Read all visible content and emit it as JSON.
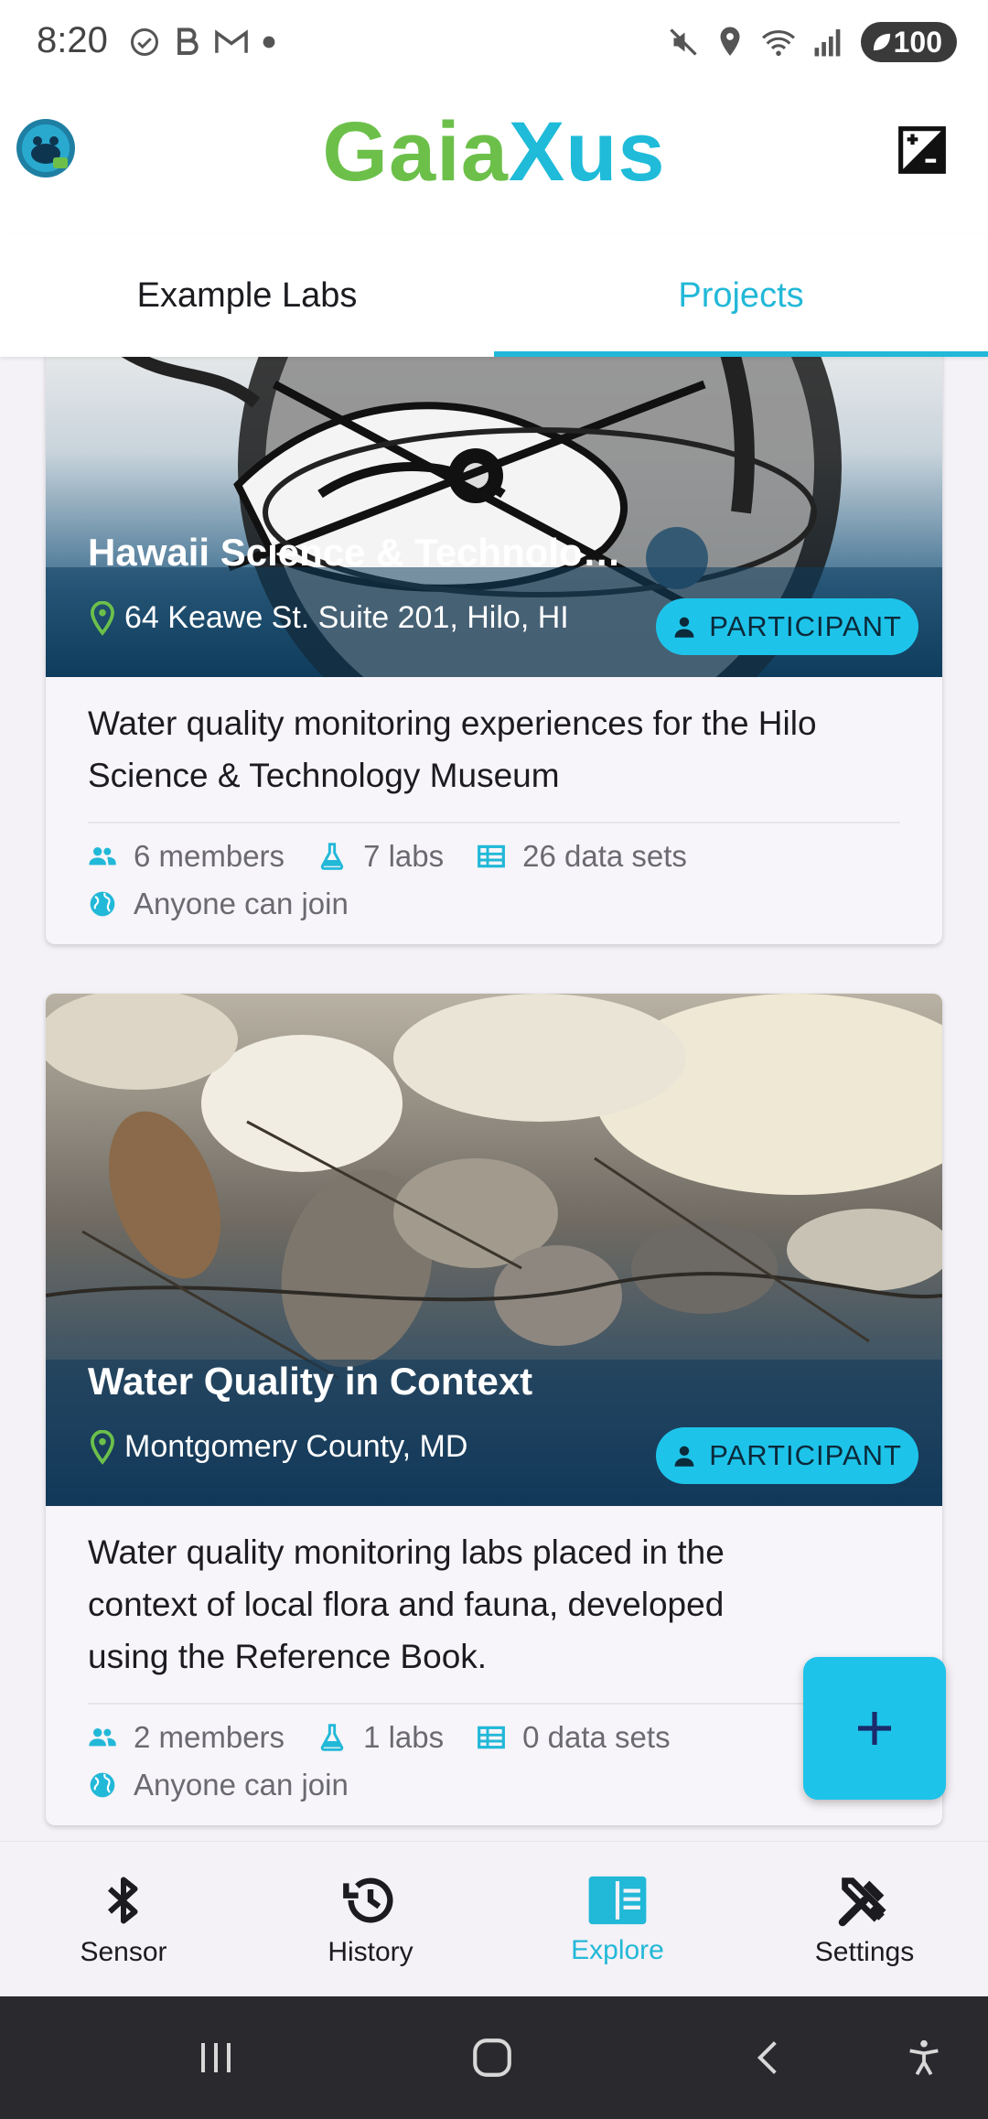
{
  "status_bar": {
    "time": "8:20",
    "battery": "100",
    "icons_left": [
      "check-circle-icon",
      "b-icon",
      "gmail-icon",
      "dot-icon"
    ],
    "icons_right": [
      "mute-icon",
      "location-icon",
      "wifi-icon",
      "signal-icon"
    ]
  },
  "app_bar": {
    "logo_part1": "Gaia",
    "logo_part2": "Xus"
  },
  "tabs": [
    {
      "label": "Example Labs",
      "active": false
    },
    {
      "label": "Projects",
      "active": true
    }
  ],
  "projects": [
    {
      "title": "Hawaii Science & Technolo…",
      "location": "64 Keawe St. Suite 201, Hilo, HI",
      "role": "PARTICIPANT",
      "description": "Water quality monitoring experiences for the Hilo Science & Technology Museum",
      "members": "6 members",
      "labs": "7 labs",
      "data_sets": "26 data sets",
      "join_policy": "Anyone can join"
    },
    {
      "title": "Water Quality in Context",
      "location": "Montgomery County, MD",
      "role": "PARTICIPANT",
      "description": "Water quality monitoring labs placed in the context of local flora and fauna, developed using the Reference Book.",
      "members": "2 members",
      "labs": "1 labs",
      "data_sets": "0 data sets",
      "join_policy": "Anyone can join"
    }
  ],
  "fab": {
    "icon": "plus-icon"
  },
  "bottom_nav": [
    {
      "label": "Sensor",
      "icon": "bluetooth-icon",
      "active": false
    },
    {
      "label": "History",
      "icon": "history-icon",
      "active": false
    },
    {
      "label": "Explore",
      "icon": "explore-icon",
      "active": true
    },
    {
      "label": "Settings",
      "icon": "tools-icon",
      "active": false
    }
  ],
  "colors": {
    "accent": "#22b8d8",
    "logo_green": "#6cc04a",
    "logo_blue": "#1fbbd9",
    "badge": "#1ec3ea"
  }
}
